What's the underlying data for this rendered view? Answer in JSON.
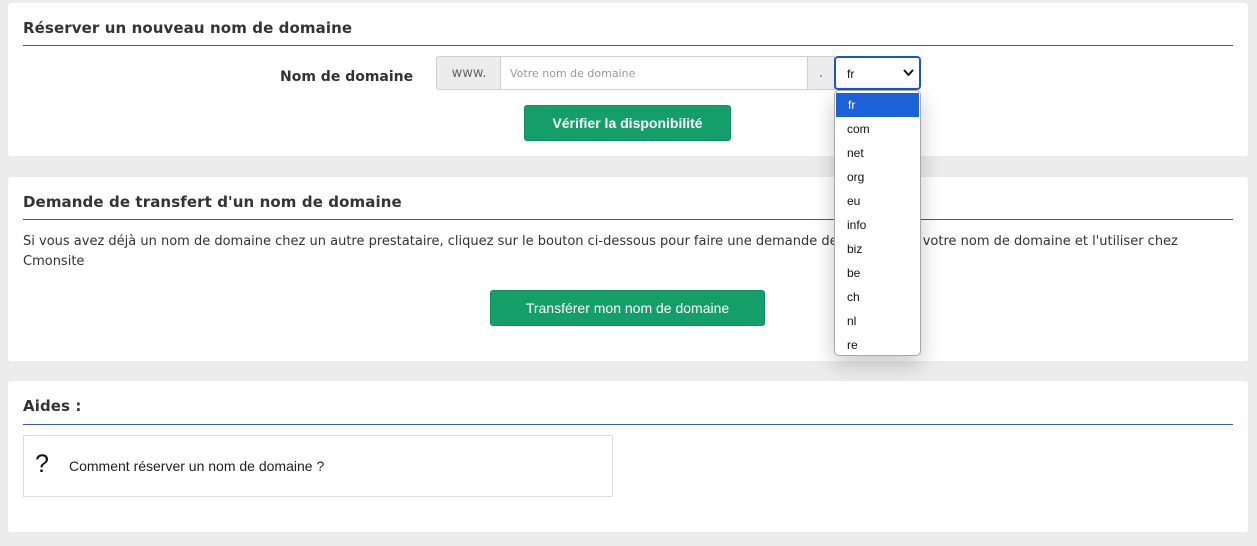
{
  "reserve": {
    "title": "Réserver un nouveau nom de domaine",
    "field_label": "Nom de domaine",
    "prefix": "www.",
    "input_placeholder": "Votre nom de domaine",
    "input_value": "",
    "dot": ".",
    "selected_tld": "fr",
    "verify_label": "Vérifier la disponibilité"
  },
  "tld_options": [
    {
      "label": "fr",
      "selected": true
    },
    {
      "label": "com"
    },
    {
      "label": "net"
    },
    {
      "label": "org"
    },
    {
      "label": "eu"
    },
    {
      "label": "info"
    },
    {
      "label": "biz"
    },
    {
      "label": "be"
    },
    {
      "label": "ch"
    },
    {
      "label": "nl"
    },
    {
      "label": "re"
    }
  ],
  "transfer": {
    "title": "Demande de transfert d'un nom de domaine",
    "description": "Si vous avez déjà un nom de domaine chez un autre prestataire, cliquez sur le bouton ci-dessous pour faire une demande de transfert de votre nom de domaine et l'utiliser chez Cmonsite",
    "button_label": "Transférer mon nom de domaine"
  },
  "help": {
    "title": "Aides :",
    "icon": "?",
    "icon_name": "question-icon",
    "item_label": "Comment réserver un nom de domaine ?"
  },
  "colors": {
    "accent_green": "#149e6a",
    "rule_blue": "#3b5aa0",
    "select_focus": "#1a56c9",
    "option_selected": "#1a62d6",
    "page_bg": "#ececec"
  }
}
